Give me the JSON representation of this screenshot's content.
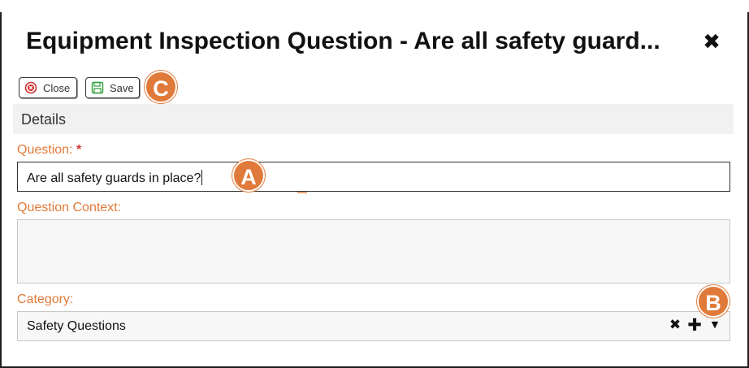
{
  "dialog": {
    "title": "Equipment Inspection Question - Are all safety guard...",
    "close_glyph": "✖"
  },
  "toolbar": {
    "close_label": "Close",
    "save_label": "Save"
  },
  "annotations": {
    "a": "A",
    "b": "B",
    "c": "C"
  },
  "section": {
    "title": "Details"
  },
  "form": {
    "question_label": "Question:",
    "required_mark": "*",
    "question_value": "Are all safety guards in place?",
    "context_label": "Question Context:",
    "context_value": "",
    "category_label": "Category:",
    "category_value": "Safety Questions",
    "category_clear_glyph": "✖",
    "category_add_glyph": "✚",
    "category_dropdown_glyph": "▼"
  },
  "colors": {
    "accent": "#e07a3a",
    "required": "#d32f2f",
    "close_icon": "#d32f2f",
    "save_icon": "#2e9e3e"
  },
  "icons": {
    "close_button": "close-circle-icon",
    "save_button": "floppy-disk-icon"
  }
}
